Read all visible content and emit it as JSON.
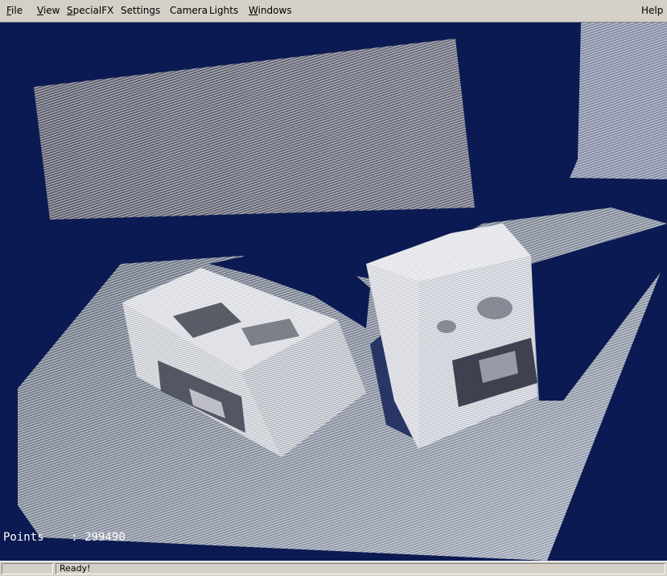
{
  "menubar": {
    "items": [
      {
        "label": "File",
        "mnemonic": "F",
        "rest": "ile"
      },
      {
        "label": "View",
        "mnemonic": "V",
        "rest": "iew"
      },
      {
        "label": "SpecialFX",
        "mnemonic": "S",
        "rest": "pecialFX"
      },
      {
        "label": "Settings",
        "mnemonic": "",
        "rest": "Settings"
      },
      {
        "label": "Camera",
        "mnemonic": "",
        "rest": "Camera"
      },
      {
        "label": "Lights",
        "mnemonic": "",
        "rest": "Lights"
      },
      {
        "label": "Windows",
        "mnemonic": "W",
        "rest": "indows"
      }
    ],
    "help": {
      "label": "Help",
      "mnemonic": "",
      "rest": "Help"
    }
  },
  "viewport": {
    "points_label": "Points",
    "points_separator": ":",
    "points_value": "299490",
    "background_color": "#0b1a52"
  },
  "statusbar": {
    "left": "",
    "message": "Ready!"
  }
}
